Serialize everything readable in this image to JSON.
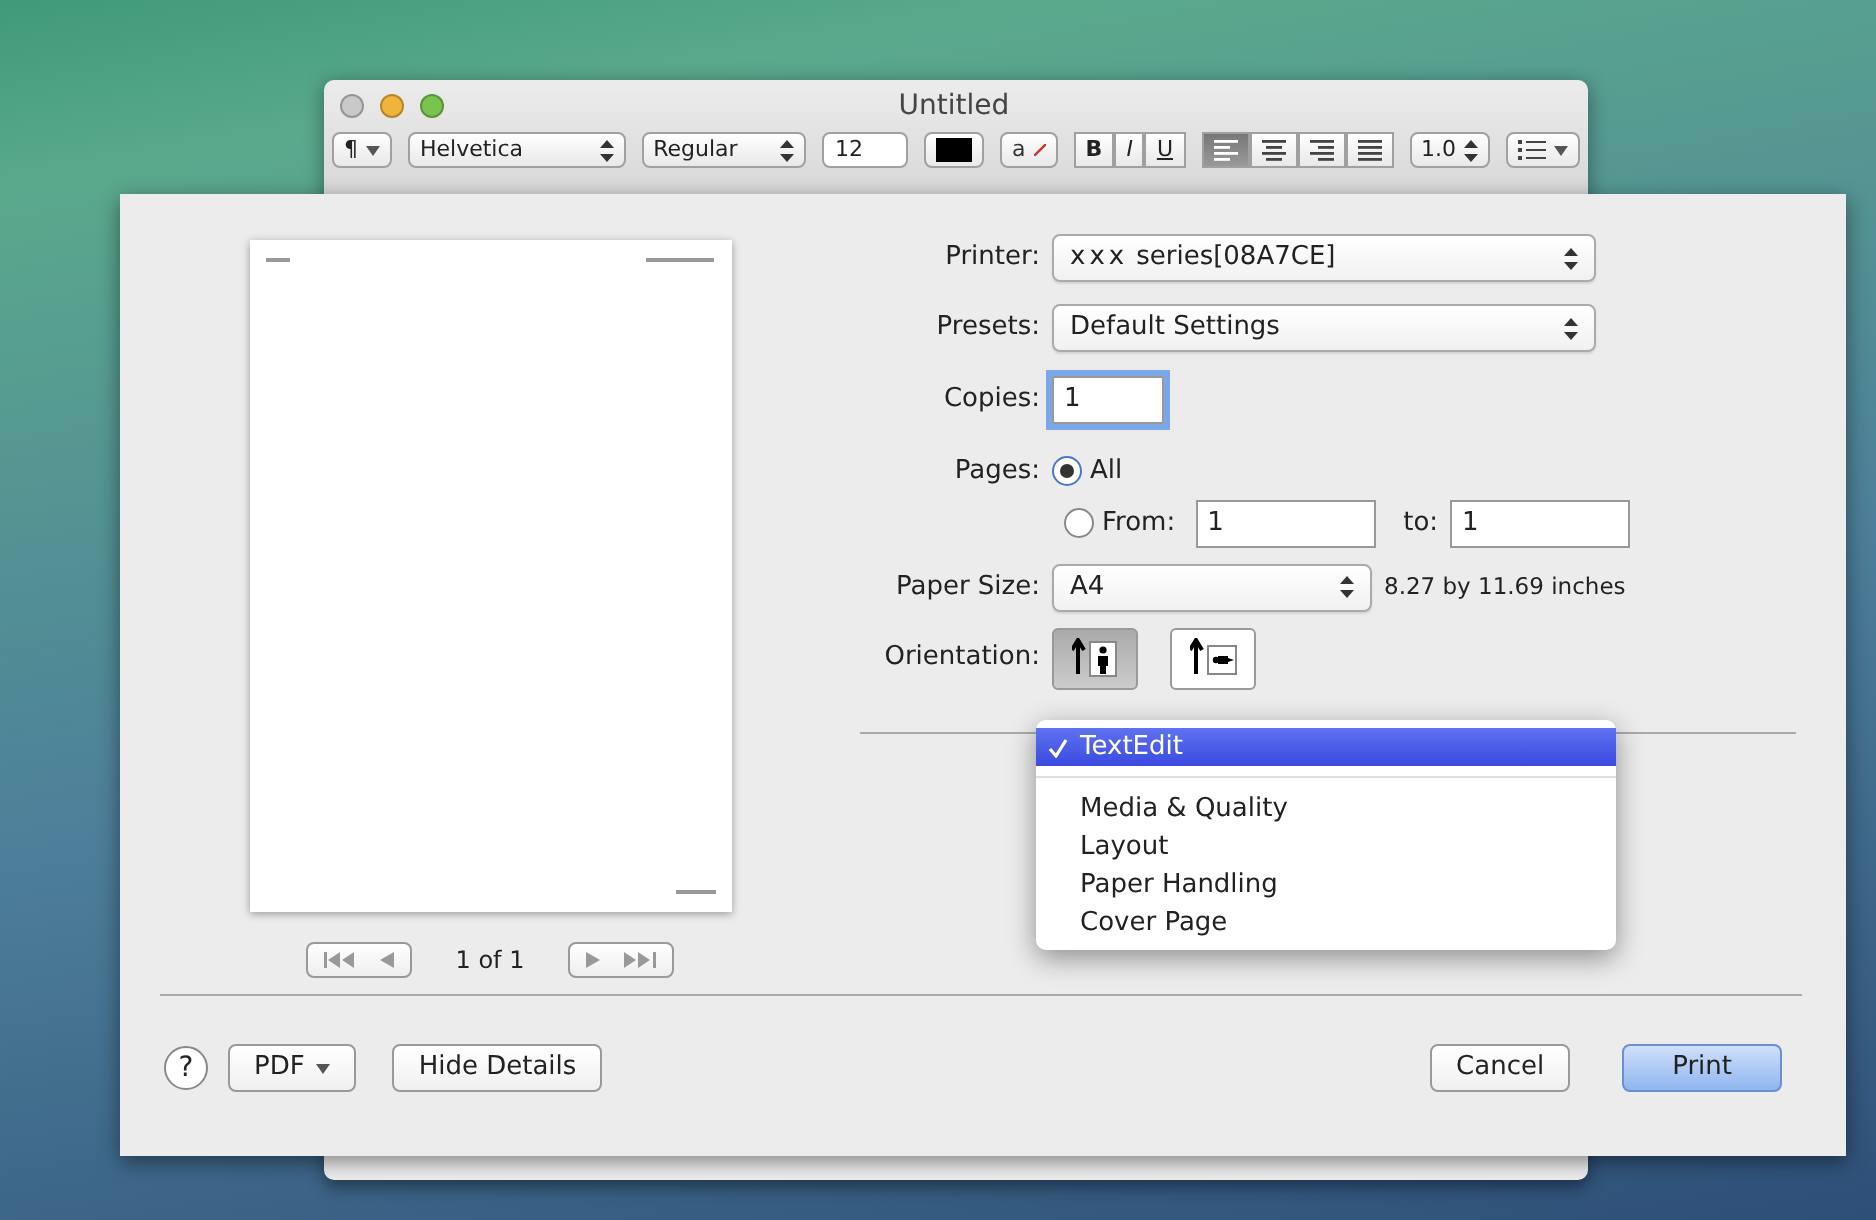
{
  "window": {
    "title": "Untitled",
    "toolbar": {
      "paragraph": "¶",
      "font": "Helvetica",
      "style": "Regular",
      "size": "12",
      "text_background": "a",
      "bold": "B",
      "italic": "I",
      "underline": "U",
      "alignment": [
        {
          "kind": "left",
          "selected": true
        },
        {
          "kind": "center",
          "selected": false
        },
        {
          "kind": "right",
          "selected": false
        },
        {
          "kind": "justify",
          "selected": false
        }
      ],
      "line_spacing": "1.0"
    }
  },
  "print_sheet": {
    "preview": {
      "page_indicator": "1 of 1"
    },
    "printer": {
      "label": "Printer:",
      "value_prefix": "xxx",
      "value": "series[08A7CE]"
    },
    "presets": {
      "label": "Presets:",
      "value": "Default Settings"
    },
    "copies": {
      "label": "Copies:",
      "value": "1"
    },
    "pages": {
      "label": "Pages:",
      "options": [
        {
          "label": "All",
          "selected": true
        },
        {
          "label": "From:",
          "selected": false
        }
      ],
      "from": "1",
      "to_label": "to:",
      "to": "1"
    },
    "paper_size": {
      "label": "Paper Size:",
      "value": "A4",
      "dimensions": "8.27 by 11.69 inches"
    },
    "orientation": {
      "label": "Orientation:",
      "options": [
        {
          "kind": "portrait",
          "selected": true
        },
        {
          "kind": "landscape",
          "selected": false
        }
      ]
    },
    "menu": {
      "items": [
        {
          "label": "TextEdit",
          "selected": true,
          "separator_after": true
        },
        {
          "label": "Media & Quality",
          "selected": false,
          "separator_after": false
        },
        {
          "label": "Layout",
          "selected": false,
          "separator_after": false
        },
        {
          "label": "Paper Handling",
          "selected": false,
          "separator_after": false
        },
        {
          "label": "Cover Page",
          "selected": false,
          "separator_after": false
        }
      ]
    },
    "help": "?",
    "pdf": "PDF",
    "hide_details": "Hide Details",
    "cancel": "Cancel",
    "print": "Print"
  }
}
